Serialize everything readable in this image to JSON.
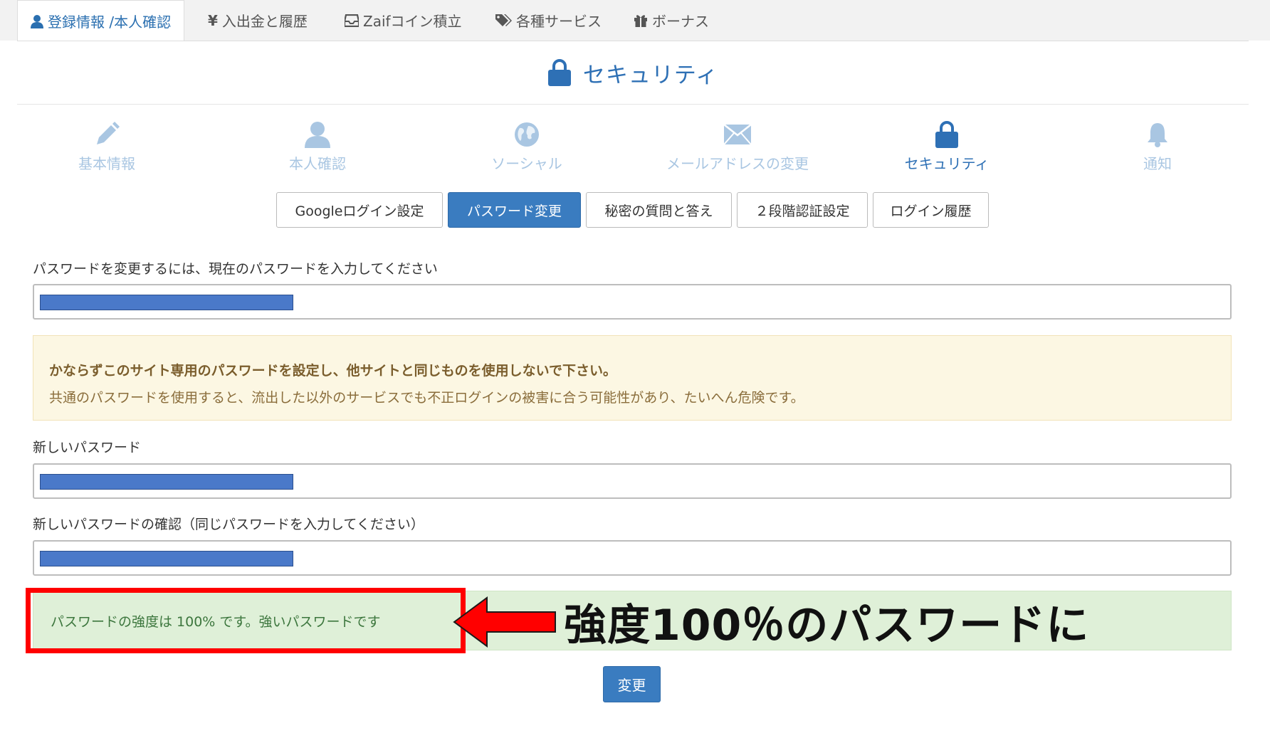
{
  "top_tabs": [
    {
      "label": "登録情報 /本人確認",
      "icon": "user-icon"
    },
    {
      "label": "入出金と履歴",
      "icon": "yen-icon"
    },
    {
      "label": "Zaifコイン積立",
      "icon": "inbox-icon"
    },
    {
      "label": "各種サービス",
      "icon": "tags-icon"
    },
    {
      "label": "ボーナス",
      "icon": "gift-icon"
    }
  ],
  "header": {
    "title": "セキュリティ",
    "icon": "lock-icon"
  },
  "sections": [
    {
      "label": "基本情報",
      "icon": "pencil-icon"
    },
    {
      "label": "本人確認",
      "icon": "user-icon"
    },
    {
      "label": "ソーシャル",
      "icon": "globe-icon"
    },
    {
      "label": "メールアドレスの変更",
      "icon": "envelope-icon"
    },
    {
      "label": "セキュリティ",
      "icon": "lock-icon"
    },
    {
      "label": "通知",
      "icon": "bell-icon"
    }
  ],
  "subtabs": [
    "Googleログイン設定",
    "パスワード変更",
    "秘密の質問と答え",
    "２段階認証設定",
    "ログイン履歴"
  ],
  "form": {
    "current_label": "パスワードを変更するには、現在のパスワードを入力してください",
    "warning_strong": "かならずこのサイト専用のパスワードを設定し、他サイトと同じものを使用しないで下さい。",
    "warning_text": "共通のパスワードを使用すると、流出した以外のサービスでも不正ログインの被害に合う可能性があり、たいへん危険です。",
    "new_label": "新しいパスワード",
    "confirm_label": "新しいパスワードの確認（同じパスワードを入力してください）",
    "strength_message": "パスワードの強度は 100% です。強いパスワードです",
    "submit_label": "変更"
  },
  "annotation": {
    "text": "強度100％のパスワードに"
  },
  "colors": {
    "accent": "#3a7cc0",
    "section_inactive": "#a9c6e2",
    "annotation_red": "#ff0000"
  }
}
